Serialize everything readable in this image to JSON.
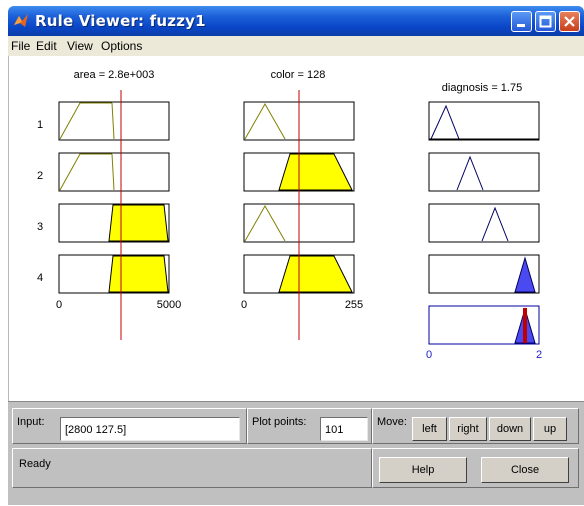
{
  "window": {
    "title": "Rule Viewer: fuzzy1"
  },
  "menu": [
    "File",
    "Edit",
    "View",
    "Options"
  ],
  "inputs": [
    {
      "header": "area = 2.8e+003",
      "range_min": "0",
      "range_max": "5000",
      "value": 2800
    },
    {
      "header": "color = 128",
      "range_min": "0",
      "range_max": "255",
      "value": 128
    }
  ],
  "output": {
    "header": "diagnosis = 1.75",
    "range_min": "0",
    "range_max": "2",
    "value": 1.75
  },
  "rules": [
    "1",
    "2",
    "3",
    "4"
  ],
  "controls": {
    "input_label": "Input:",
    "input_value": "[2800 127.5]",
    "plot_points_label": "Plot points:",
    "plot_points_value": "101",
    "move_label": "Move:",
    "move_buttons": [
      "left",
      "right",
      "down",
      "up"
    ],
    "status": "Ready",
    "help_label": "Help",
    "close_label": "Close"
  },
  "colors": {
    "fill": "#ffff00",
    "output_fill": "#4a4af0",
    "index_line": "#c00000",
    "mf_line": "#808000",
    "output_line": "#000060"
  }
}
